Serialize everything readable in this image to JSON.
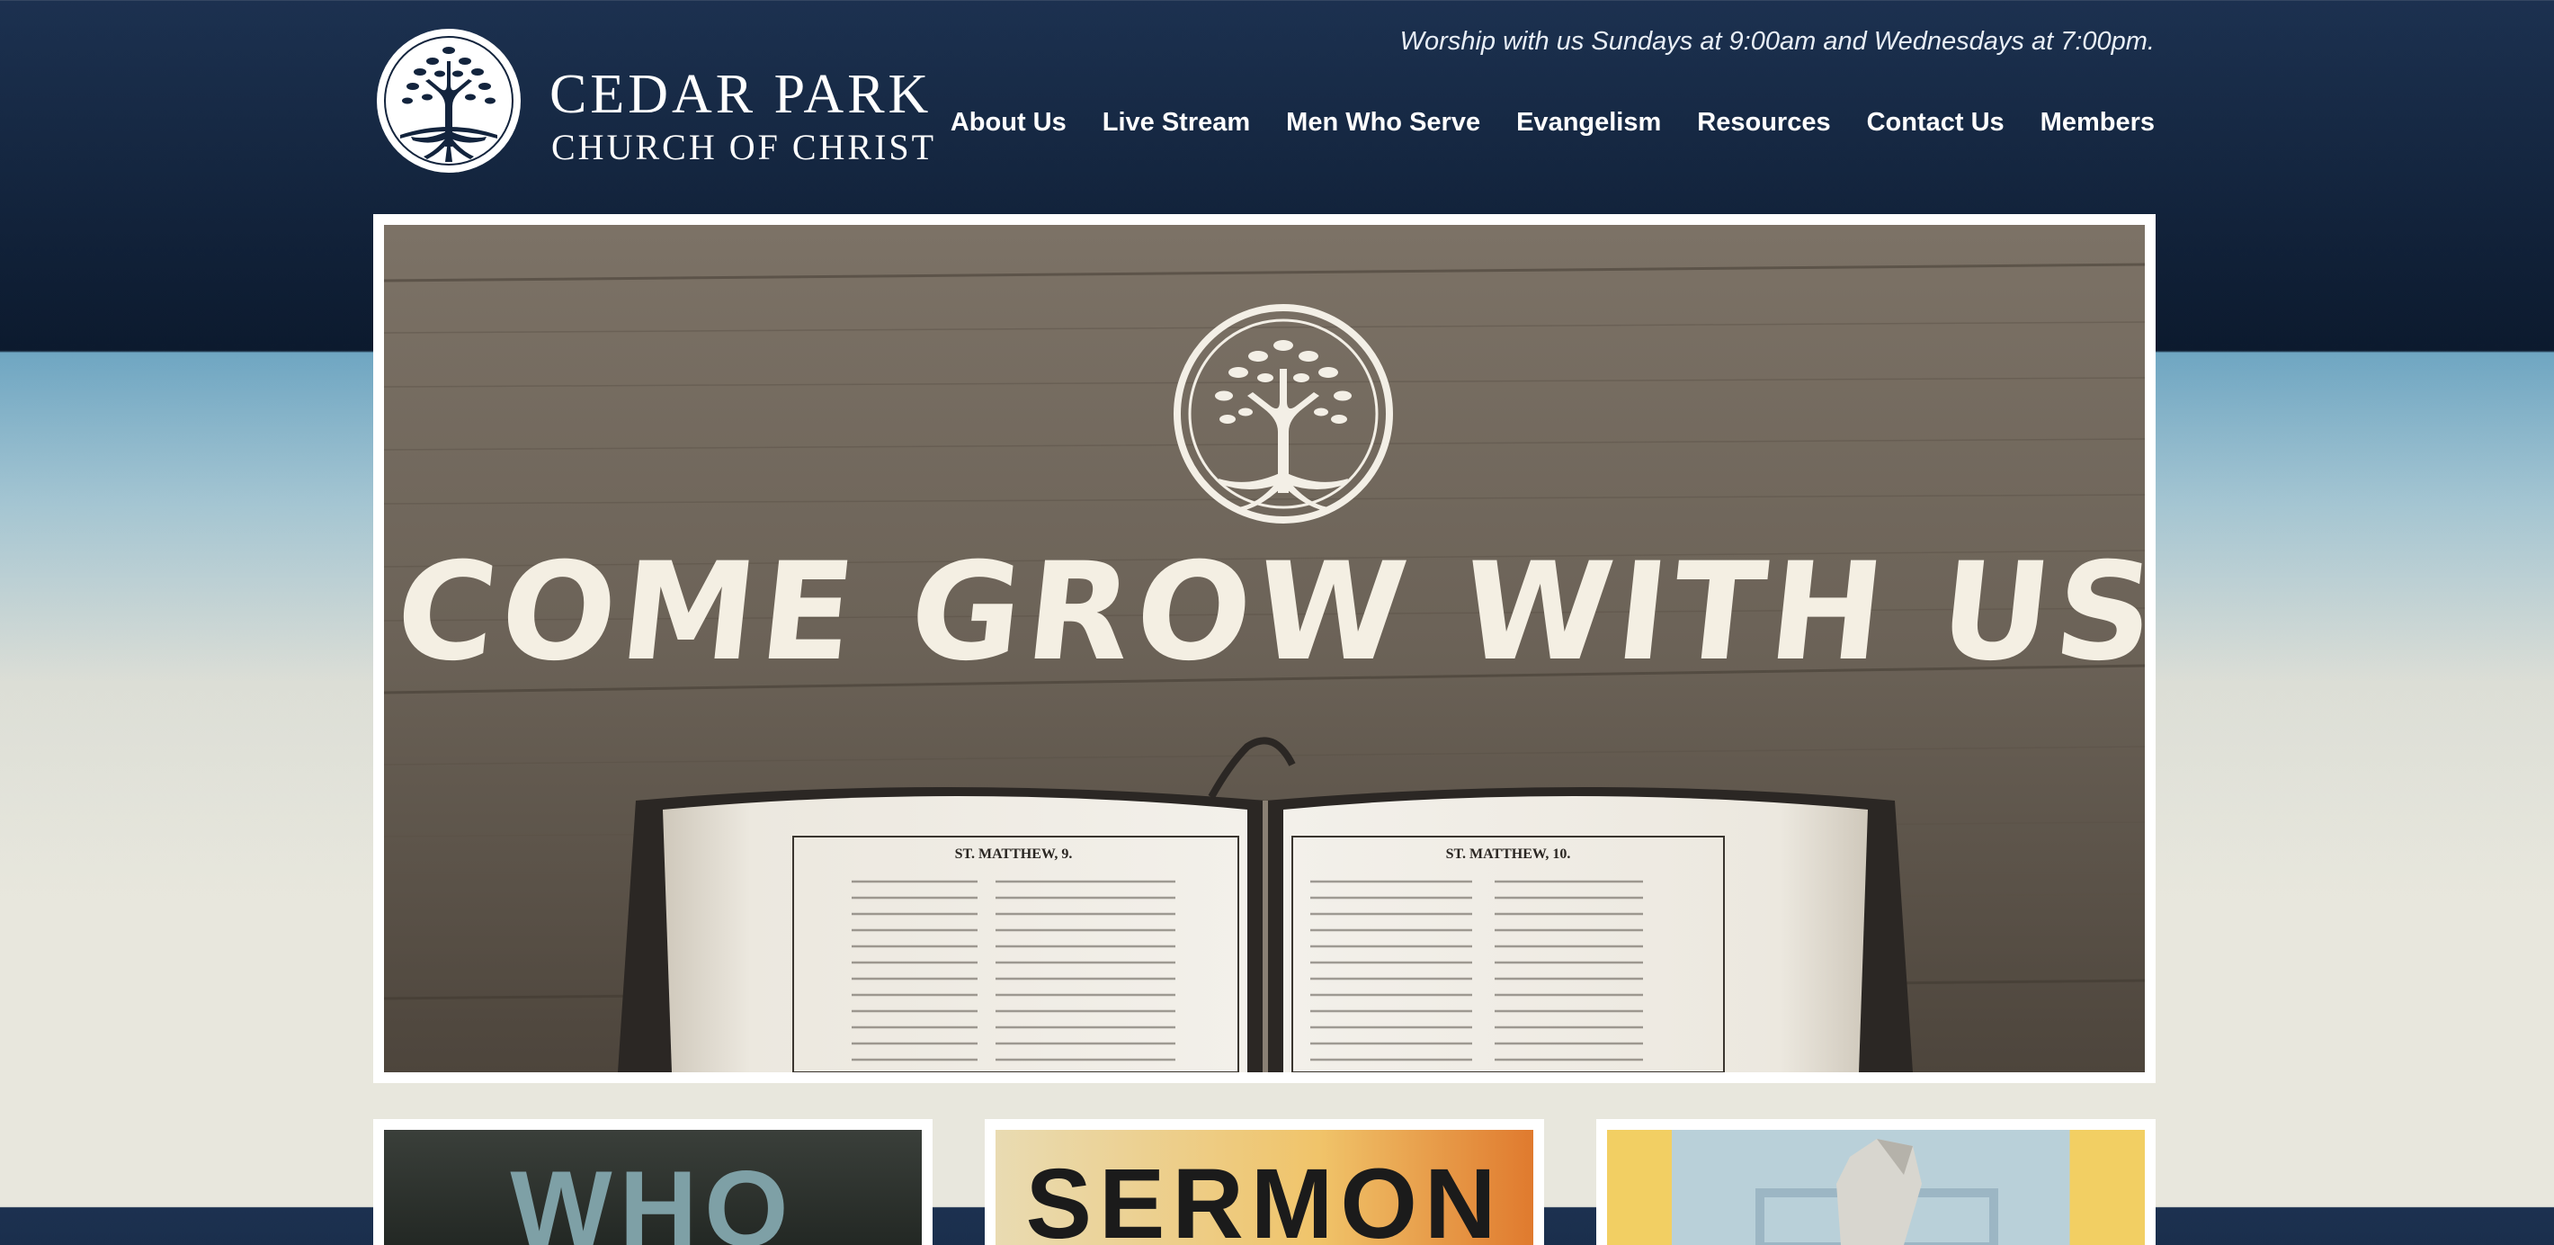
{
  "header": {
    "logo_line1": "CEDAR PARK",
    "logo_line2": "CHURCH OF CHRIST",
    "tagline": "Worship with us Sundays at 9:00am and Wednesdays at 7:00pm."
  },
  "nav": {
    "items": [
      {
        "label": "About Us"
      },
      {
        "label": "Live Stream"
      },
      {
        "label": "Men Who Serve"
      },
      {
        "label": "Evangelism"
      },
      {
        "label": "Resources"
      },
      {
        "label": "Contact Us"
      },
      {
        "label": "Members"
      }
    ]
  },
  "hero": {
    "headline": "COME GROW WITH US",
    "bible_left_running_head": "ST. MATTHEW, 9.",
    "bible_right_running_head": "ST. MATTHEW, 10."
  },
  "cards": [
    {
      "title": "WHO"
    },
    {
      "title": "SERMON"
    },
    {
      "title": ""
    }
  ],
  "colors": {
    "header_navy": "#0c1a2e",
    "sky_blue": "#6fa6c2",
    "page_cream": "#e8e7dd",
    "frame_white": "#ffffff"
  }
}
